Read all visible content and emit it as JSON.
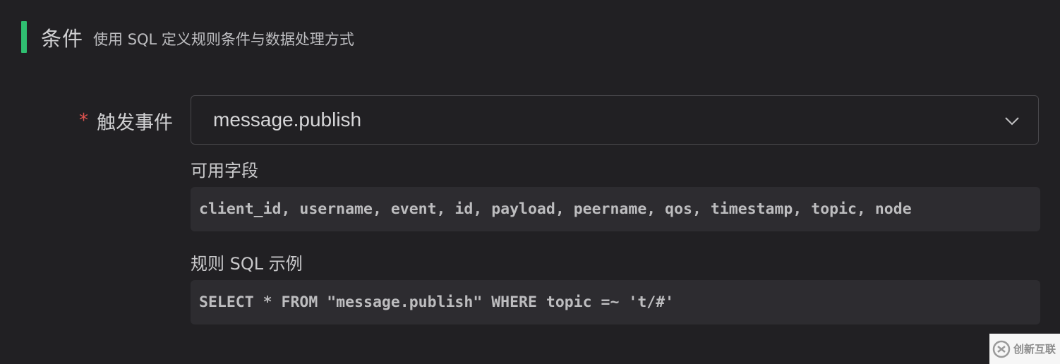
{
  "section": {
    "title": "条件",
    "description": "使用 SQL 定义规则条件与数据处理方式",
    "accent_color": "#2fbf71"
  },
  "form": {
    "required_mark": "*",
    "trigger_label": "触发事件",
    "trigger_value": "message.publish",
    "trigger_icon": "chevron-down-icon"
  },
  "fields": {
    "caption": "可用字段",
    "value": "client_id, username, event, id, payload, peername, qos, timestamp, topic, node"
  },
  "sql_example": {
    "caption": "规则 SQL 示例",
    "value": "SELECT * FROM \"message.publish\" WHERE topic =~ 't/#'"
  },
  "watermark": {
    "text": "创新互联",
    "icon": "logo-icon"
  }
}
